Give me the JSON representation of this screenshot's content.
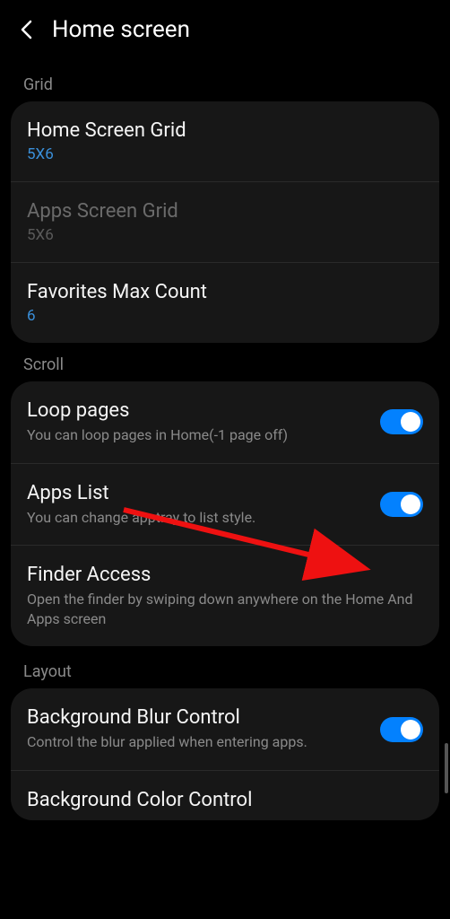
{
  "header": {
    "title": "Home screen"
  },
  "sections": {
    "grid": {
      "label": "Grid",
      "home_screen_grid": {
        "title": "Home Screen Grid",
        "value": "5X6"
      },
      "apps_screen_grid": {
        "title": "Apps Screen Grid",
        "value": "5X6"
      },
      "favorites_max_count": {
        "title": "Favorites Max Count",
        "value": "6"
      }
    },
    "scroll": {
      "label": "Scroll",
      "loop_pages": {
        "title": "Loop pages",
        "desc": "You can loop pages in Home(-1 page off)"
      },
      "apps_list": {
        "title": "Apps List",
        "desc": "You can change apptray to list style."
      },
      "finder_access": {
        "title": "Finder Access",
        "desc": "Open the finder by swiping down anywhere on the Home And Apps screen"
      }
    },
    "layout": {
      "label": "Layout",
      "bg_blur": {
        "title": "Background Blur Control",
        "desc": "Control the blur applied when entering apps."
      },
      "bg_color": {
        "title": "Background Color Control"
      }
    }
  }
}
